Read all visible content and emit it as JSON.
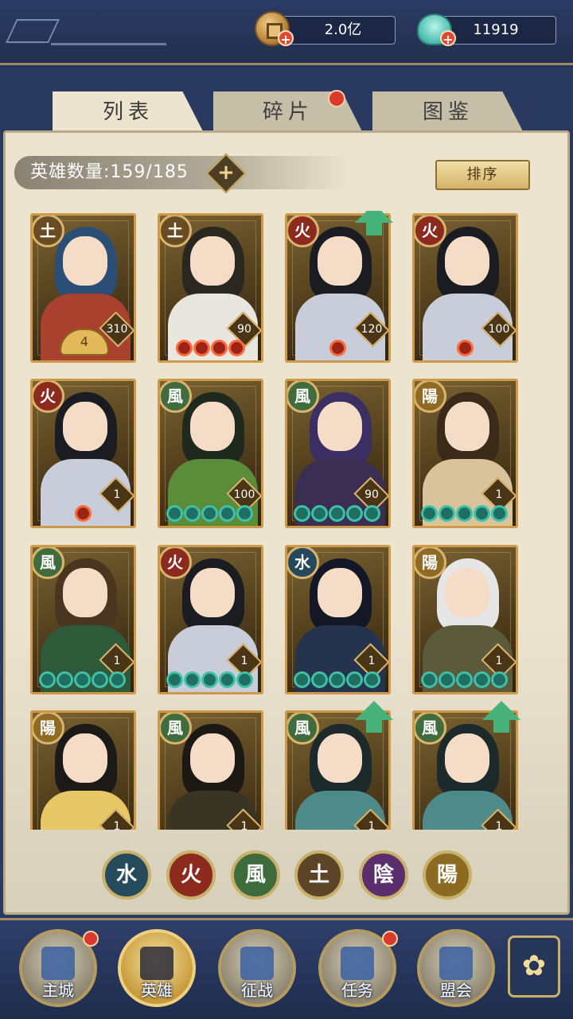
{
  "header": {
    "coins": {
      "value": "2.0亿",
      "icon": "copper-coin-icon"
    },
    "shells": {
      "value": "11919",
      "icon": "jade-shell-icon"
    }
  },
  "tabs": [
    {
      "label": "列表",
      "active": true,
      "badge": false
    },
    {
      "label": "碎片",
      "active": false,
      "badge": true
    },
    {
      "label": "图鉴",
      "active": false,
      "badge": false
    }
  ],
  "hero_count": {
    "label": "英雄数量:",
    "value": "159/185"
  },
  "sort_button": "排序",
  "heroes": [
    {
      "element": "土",
      "type": "earth",
      "level": "310",
      "crown": "4",
      "stars": 0,
      "star_color": "",
      "upgrade": false,
      "hair": "#2a4e76",
      "body": "#a8422f"
    },
    {
      "element": "土",
      "type": "earth",
      "level": "90",
      "crown": "",
      "stars": 4,
      "star_color": "red",
      "upgrade": false,
      "hair": "#2a2620",
      "body": "#e9e6e0"
    },
    {
      "element": "火",
      "type": "fire",
      "level": "120",
      "crown": "",
      "stars": 1,
      "star_color": "red",
      "upgrade": true,
      "hair": "#1b1b22",
      "body": "#c9ccd9"
    },
    {
      "element": "火",
      "type": "fire",
      "level": "100",
      "crown": "",
      "stars": 1,
      "star_color": "red",
      "upgrade": false,
      "hair": "#1b1b22",
      "body": "#c9ccd9"
    },
    {
      "element": "火",
      "type": "fire",
      "level": "1",
      "crown": "",
      "stars": 1,
      "star_color": "red",
      "upgrade": false,
      "hair": "#1b1b22",
      "body": "#c9ccd9"
    },
    {
      "element": "風",
      "type": "wind",
      "level": "100",
      "crown": "",
      "stars": 5,
      "star_color": "teal",
      "upgrade": false,
      "hair": "#1f2a1e",
      "body": "#5a8c3a"
    },
    {
      "element": "風",
      "type": "wind",
      "level": "90",
      "crown": "",
      "stars": 5,
      "star_color": "teal",
      "upgrade": false,
      "hair": "#3b2e63",
      "body": "#3a2f52"
    },
    {
      "element": "陽",
      "type": "yang",
      "level": "1",
      "crown": "",
      "stars": 5,
      "star_color": "teal",
      "upgrade": false,
      "hair": "#3a2a1a",
      "body": "#d9c39a"
    },
    {
      "element": "風",
      "type": "wind",
      "level": "1",
      "crown": "",
      "stars": 5,
      "star_color": "teal",
      "upgrade": false,
      "hair": "#4a3520",
      "body": "#2f5a3a"
    },
    {
      "element": "火",
      "type": "fire",
      "level": "1",
      "crown": "",
      "stars": 5,
      "star_color": "teal",
      "upgrade": false,
      "hair": "#1b1b22",
      "body": "#c9ccd9"
    },
    {
      "element": "水",
      "type": "water",
      "level": "1",
      "crown": "",
      "stars": 5,
      "star_color": "teal",
      "upgrade": false,
      "hair": "#141826",
      "body": "#26334f"
    },
    {
      "element": "陽",
      "type": "yang",
      "level": "1",
      "crown": "",
      "stars": 5,
      "star_color": "teal",
      "upgrade": false,
      "hair": "#e6e6e6",
      "body": "#5b5a3a"
    },
    {
      "element": "陽",
      "type": "yang",
      "level": "1",
      "crown": "",
      "stars": 0,
      "star_color": "",
      "upgrade": false,
      "hair": "#1c1a18",
      "body": "#e6c867"
    },
    {
      "element": "風",
      "type": "wind",
      "level": "1",
      "crown": "",
      "stars": 0,
      "star_color": "",
      "upgrade": false,
      "hair": "#1c1814",
      "body": "#3a3424"
    },
    {
      "element": "風",
      "type": "wind",
      "level": "1",
      "crown": "",
      "stars": 0,
      "star_color": "",
      "upgrade": true,
      "hair": "#1d2a2c",
      "body": "#4f8a8a"
    },
    {
      "element": "風",
      "type": "wind",
      "level": "1",
      "crown": "",
      "stars": 0,
      "star_color": "",
      "upgrade": true,
      "hair": "#1d2a2c",
      "body": "#4f8a8a"
    }
  ],
  "element_filters": [
    {
      "glyph": "水",
      "name": "water",
      "color": "#264b5c"
    },
    {
      "glyph": "火",
      "name": "fire",
      "color": "#8c2a1d"
    },
    {
      "glyph": "風",
      "name": "wind",
      "color": "#3e6b3b"
    },
    {
      "glyph": "土",
      "name": "earth",
      "color": "#5c4526"
    },
    {
      "glyph": "陰",
      "name": "yin",
      "color": "#5b2f6e"
    },
    {
      "glyph": "陽",
      "name": "yang",
      "color": "#8c6a22"
    }
  ],
  "nav": [
    {
      "label": "主城",
      "badge": true,
      "active": false
    },
    {
      "label": "英雄",
      "badge": false,
      "active": true
    },
    {
      "label": "征战",
      "badge": false,
      "active": false
    },
    {
      "label": "任务",
      "badge": true,
      "active": false
    },
    {
      "label": "盟会",
      "badge": false,
      "active": false
    }
  ],
  "menu_icon": "✿"
}
